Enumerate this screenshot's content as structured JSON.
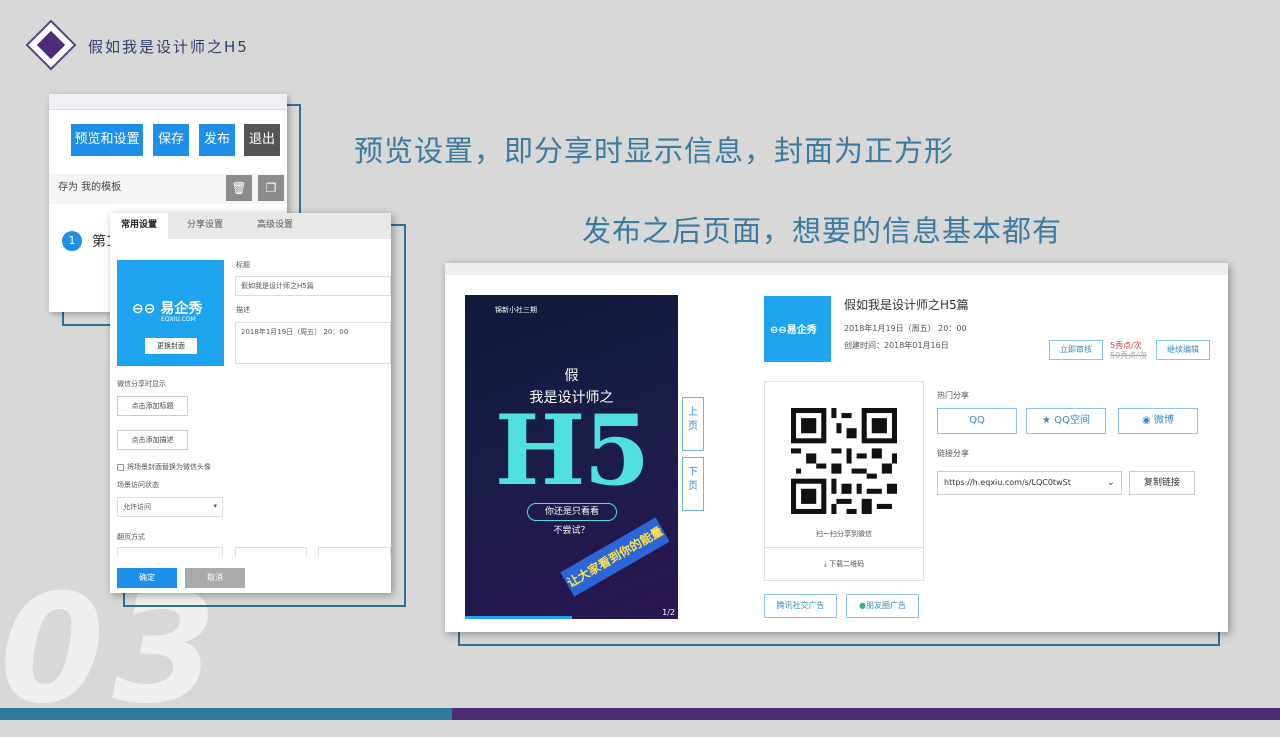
{
  "header": {
    "title": "假如我是设计师之H5"
  },
  "headings": {
    "preview": "预览设置，即分享时显示信息，封面为正方形",
    "published": "发布之后页面，想要的信息基本都有"
  },
  "section_number": "03",
  "editor": {
    "buttons": {
      "preview": "预览和设置",
      "save": "保存",
      "publish": "发布",
      "exit": "退出"
    },
    "template_row": "存为 我的模板",
    "icons": {
      "delete": "trash-icon",
      "copy": "copy-icon"
    },
    "step": {
      "number": "1",
      "label": "第1"
    }
  },
  "settings": {
    "tabs": [
      "常用设置",
      "分享设置",
      "高级设置"
    ],
    "cover": {
      "brand": "易企秀",
      "domain": "EQXIU.COM",
      "change_button": "更换封面"
    },
    "title_label": "标题",
    "title_value": "假如我是设计师之H5篇",
    "desc_label": "描述",
    "desc_value": "2018年1月19日（周五） 20：00",
    "wechat_label": "微信分享时显示",
    "add_title": "点击添加标题",
    "add_desc": "点击添加描述",
    "avatar_option": "将场景封面替换为微信头像",
    "access_label": "场景访问状态",
    "access_value": "允许访问",
    "flip_label": "翻页方式",
    "ok": "确定",
    "cancel": "取消"
  },
  "published": {
    "poster": {
      "org": "锦新小社三期",
      "line1": "假",
      "line2": "我是设计师之",
      "h5": "H5",
      "pill": "你还是只看看",
      "sub": "不尝试？",
      "banner": "让大家看到你的能量",
      "page": "1/2"
    },
    "nav": {
      "prev": "上\n页",
      "next": "下\n页"
    },
    "title": "假如我是设计师之H5篇",
    "date": "2018年1月19日（周五） 20：00",
    "created": "创建时间：2018年01月16日",
    "review_button": "立即审核",
    "price_now": "5秀点/次",
    "price_old": "50秀点/次",
    "edit_button": "继续编辑",
    "qr_caption": "扫一扫分享到微信",
    "download": "下载二维码",
    "hot_share_label": "热门分享",
    "share": [
      "QQ",
      "QQ空间",
      "微博"
    ],
    "link_label": "链接分享",
    "link_value": "https://h.eqxiu.com/s/LQC0twSt",
    "copy_button": "复制链接",
    "ad_buttons": [
      "腾讯社交广告",
      "朋友圈广告"
    ]
  },
  "colors": {
    "accent_blue": "#1e8fe8",
    "heading": "#3d7a9e",
    "purple": "#4b2a78",
    "teal_bar": "#2f7a9a",
    "h5_cyan": "#4fe0df"
  }
}
